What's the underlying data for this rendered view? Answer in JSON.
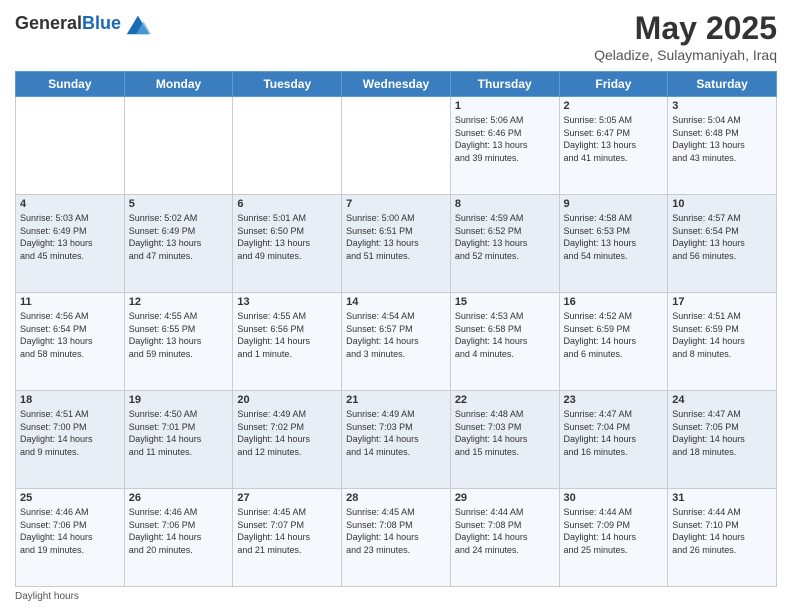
{
  "header": {
    "logo_general": "General",
    "logo_blue": "Blue",
    "title": "May 2025",
    "subtitle": "Qeladize, Sulaymaniyah, Iraq"
  },
  "days_of_week": [
    "Sunday",
    "Monday",
    "Tuesday",
    "Wednesday",
    "Thursday",
    "Friday",
    "Saturday"
  ],
  "weeks": [
    [
      {
        "day": "",
        "info": ""
      },
      {
        "day": "",
        "info": ""
      },
      {
        "day": "",
        "info": ""
      },
      {
        "day": "",
        "info": ""
      },
      {
        "day": "1",
        "info": "Sunrise: 5:06 AM\nSunset: 6:46 PM\nDaylight: 13 hours\nand 39 minutes."
      },
      {
        "day": "2",
        "info": "Sunrise: 5:05 AM\nSunset: 6:47 PM\nDaylight: 13 hours\nand 41 minutes."
      },
      {
        "day": "3",
        "info": "Sunrise: 5:04 AM\nSunset: 6:48 PM\nDaylight: 13 hours\nand 43 minutes."
      }
    ],
    [
      {
        "day": "4",
        "info": "Sunrise: 5:03 AM\nSunset: 6:49 PM\nDaylight: 13 hours\nand 45 minutes."
      },
      {
        "day": "5",
        "info": "Sunrise: 5:02 AM\nSunset: 6:49 PM\nDaylight: 13 hours\nand 47 minutes."
      },
      {
        "day": "6",
        "info": "Sunrise: 5:01 AM\nSunset: 6:50 PM\nDaylight: 13 hours\nand 49 minutes."
      },
      {
        "day": "7",
        "info": "Sunrise: 5:00 AM\nSunset: 6:51 PM\nDaylight: 13 hours\nand 51 minutes."
      },
      {
        "day": "8",
        "info": "Sunrise: 4:59 AM\nSunset: 6:52 PM\nDaylight: 13 hours\nand 52 minutes."
      },
      {
        "day": "9",
        "info": "Sunrise: 4:58 AM\nSunset: 6:53 PM\nDaylight: 13 hours\nand 54 minutes."
      },
      {
        "day": "10",
        "info": "Sunrise: 4:57 AM\nSunset: 6:54 PM\nDaylight: 13 hours\nand 56 minutes."
      }
    ],
    [
      {
        "day": "11",
        "info": "Sunrise: 4:56 AM\nSunset: 6:54 PM\nDaylight: 13 hours\nand 58 minutes."
      },
      {
        "day": "12",
        "info": "Sunrise: 4:55 AM\nSunset: 6:55 PM\nDaylight: 13 hours\nand 59 minutes."
      },
      {
        "day": "13",
        "info": "Sunrise: 4:55 AM\nSunset: 6:56 PM\nDaylight: 14 hours\nand 1 minute."
      },
      {
        "day": "14",
        "info": "Sunrise: 4:54 AM\nSunset: 6:57 PM\nDaylight: 14 hours\nand 3 minutes."
      },
      {
        "day": "15",
        "info": "Sunrise: 4:53 AM\nSunset: 6:58 PM\nDaylight: 14 hours\nand 4 minutes."
      },
      {
        "day": "16",
        "info": "Sunrise: 4:52 AM\nSunset: 6:59 PM\nDaylight: 14 hours\nand 6 minutes."
      },
      {
        "day": "17",
        "info": "Sunrise: 4:51 AM\nSunset: 6:59 PM\nDaylight: 14 hours\nand 8 minutes."
      }
    ],
    [
      {
        "day": "18",
        "info": "Sunrise: 4:51 AM\nSunset: 7:00 PM\nDaylight: 14 hours\nand 9 minutes."
      },
      {
        "day": "19",
        "info": "Sunrise: 4:50 AM\nSunset: 7:01 PM\nDaylight: 14 hours\nand 11 minutes."
      },
      {
        "day": "20",
        "info": "Sunrise: 4:49 AM\nSunset: 7:02 PM\nDaylight: 14 hours\nand 12 minutes."
      },
      {
        "day": "21",
        "info": "Sunrise: 4:49 AM\nSunset: 7:03 PM\nDaylight: 14 hours\nand 14 minutes."
      },
      {
        "day": "22",
        "info": "Sunrise: 4:48 AM\nSunset: 7:03 PM\nDaylight: 14 hours\nand 15 minutes."
      },
      {
        "day": "23",
        "info": "Sunrise: 4:47 AM\nSunset: 7:04 PM\nDaylight: 14 hours\nand 16 minutes."
      },
      {
        "day": "24",
        "info": "Sunrise: 4:47 AM\nSunset: 7:05 PM\nDaylight: 14 hours\nand 18 minutes."
      }
    ],
    [
      {
        "day": "25",
        "info": "Sunrise: 4:46 AM\nSunset: 7:06 PM\nDaylight: 14 hours\nand 19 minutes."
      },
      {
        "day": "26",
        "info": "Sunrise: 4:46 AM\nSunset: 7:06 PM\nDaylight: 14 hours\nand 20 minutes."
      },
      {
        "day": "27",
        "info": "Sunrise: 4:45 AM\nSunset: 7:07 PM\nDaylight: 14 hours\nand 21 minutes."
      },
      {
        "day": "28",
        "info": "Sunrise: 4:45 AM\nSunset: 7:08 PM\nDaylight: 14 hours\nand 23 minutes."
      },
      {
        "day": "29",
        "info": "Sunrise: 4:44 AM\nSunset: 7:08 PM\nDaylight: 14 hours\nand 24 minutes."
      },
      {
        "day": "30",
        "info": "Sunrise: 4:44 AM\nSunset: 7:09 PM\nDaylight: 14 hours\nand 25 minutes."
      },
      {
        "day": "31",
        "info": "Sunrise: 4:44 AM\nSunset: 7:10 PM\nDaylight: 14 hours\nand 26 minutes."
      }
    ]
  ],
  "footer": {
    "note": "Daylight hours"
  }
}
